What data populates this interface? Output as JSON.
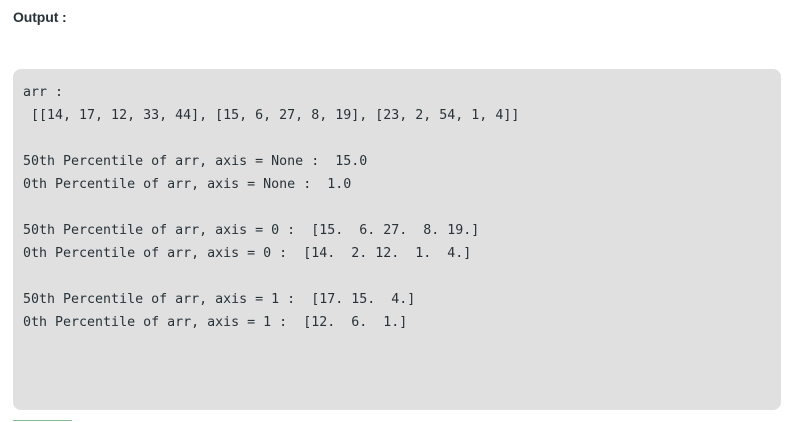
{
  "heading": "Output :",
  "output_lines": [
    "arr :",
    " [[14, 17, 12, 33, 44], [15, 6, 27, 8, 19], [23, 2, 54, 1, 4]]",
    "",
    "50th Percentile of arr, axis = None :  15.0",
    "0th Percentile of arr, axis = None :  1.0",
    "",
    "50th Percentile of arr, axis = 0 :  [15.  6. 27.  8. 19.]",
    "0th Percentile of arr, axis = 0 :  [14.  2. 12.  1.  4.]",
    "",
    "50th Percentile of arr, axis = 1 :  [17. 15.  4.]",
    "0th Percentile of arr, axis = 1 :  [12.  6.  1.]"
  ],
  "colors": {
    "box_background": "#e0e0e0",
    "text": "#273239"
  }
}
